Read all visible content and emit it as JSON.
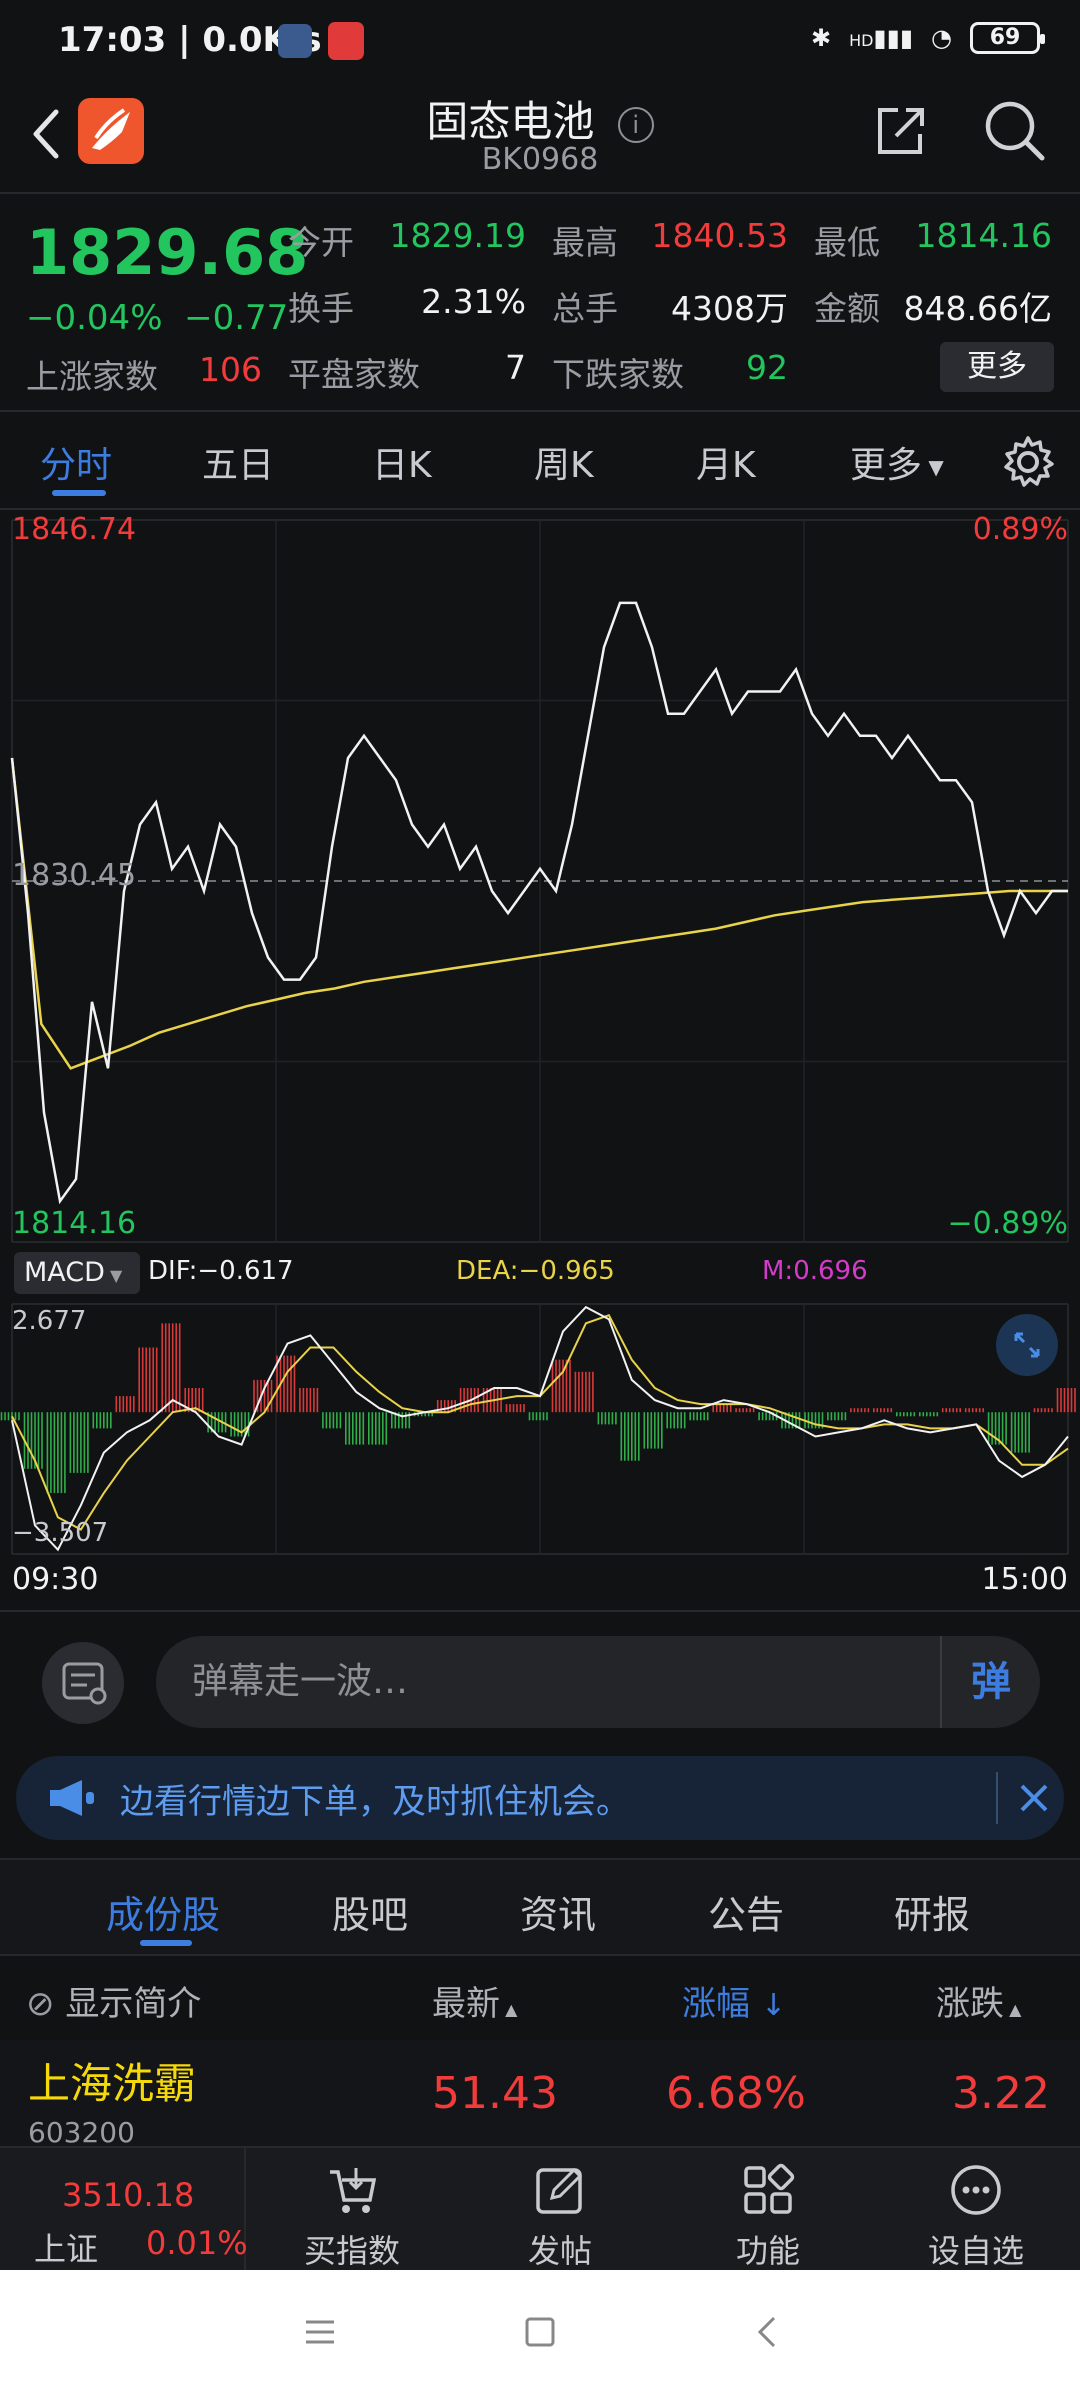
{
  "status_bar": {
    "time": "17:03",
    "network_speed": "0.0K/s",
    "battery": "69",
    "signal_label": "HD"
  },
  "header": {
    "title": "固态电池",
    "code": "BK0968",
    "icons": [
      "back-icon",
      "app-logo",
      "info-icon",
      "share-icon",
      "search-icon"
    ]
  },
  "quote": {
    "price": "1829.68",
    "change_pct": "−0.04%",
    "change": "−0.77",
    "open_label": "今开",
    "open": "1829.19",
    "high_label": "最高",
    "high": "1840.53",
    "low_label": "最低",
    "low": "1814.16",
    "turnover_label": "换手",
    "turnover": "2.31%",
    "volume_label": "总手",
    "volume": "4308万",
    "amount_label": "金额",
    "amount": "848.66亿",
    "up_label": "上涨家数",
    "up_count": "106",
    "flat_label": "平盘家数",
    "flat_count": "7",
    "down_label": "下跌家数",
    "down_count": "92",
    "more": "更多"
  },
  "tabs": [
    "分时",
    "五日",
    "日K",
    "周K",
    "月K",
    "更多"
  ],
  "chart_data": {
    "type": "line",
    "price_top": "1846.74",
    "price_mid": "1830.45",
    "price_bottom": "1814.16",
    "pct_top": "0.89%",
    "pct_bottom": "−0.89%",
    "time_start": "09:30",
    "time_end": "15:00",
    "ylim": [
      1814.16,
      1846.74
    ],
    "price_series": [
      1836,
      1829,
      1820,
      1816,
      1817,
      1825,
      1822,
      1830,
      1833,
      1834,
      1831,
      1832,
      1830,
      1833,
      1832,
      1829,
      1827,
      1826,
      1826,
      1827,
      1832,
      1836,
      1837,
      1836,
      1835,
      1833,
      1832,
      1833,
      1831,
      1832,
      1830,
      1829,
      1830,
      1831,
      1830,
      1833,
      1837,
      1841,
      1843,
      1843,
      1841,
      1838,
      1838,
      1839,
      1840,
      1838,
      1839,
      1839,
      1839,
      1840,
      1838,
      1837,
      1838,
      1837,
      1837,
      1836,
      1837,
      1836,
      1835,
      1835,
      1834,
      1830,
      1828,
      1830,
      1829,
      1830,
      1830
    ],
    "avg_series": [
      1836,
      1824,
      1822,
      1822.5,
      1823,
      1823.6,
      1824,
      1824.4,
      1824.8,
      1825.1,
      1825.4,
      1825.6,
      1825.9,
      1826.1,
      1826.3,
      1826.5,
      1826.7,
      1826.9,
      1827.1,
      1827.3,
      1827.5,
      1827.7,
      1827.9,
      1828.1,
      1828.3,
      1828.6,
      1828.9,
      1829.1,
      1829.3,
      1829.5,
      1829.6,
      1829.7,
      1829.8,
      1829.9,
      1830.0,
      1830.0,
      1830.0
    ],
    "macd": {
      "indicator": "MACD",
      "dif_label": "DIF:−0.617",
      "dea_label": "DEA:−0.965",
      "m_label": "M:0.696",
      "ylim_top": "2.677",
      "ylim_bottom": "−3.507",
      "range": [
        -3.507,
        2.677
      ],
      "dif_series": [
        -0.2,
        -2.8,
        -3.4,
        -2.3,
        -1.0,
        -0.5,
        -0.2,
        0.3,
        0.0,
        -0.6,
        -0.8,
        0.6,
        1.7,
        1.9,
        1.2,
        0.5,
        0.1,
        -0.1,
        0.0,
        0.1,
        0.3,
        0.6,
        0.6,
        0.4,
        2.0,
        2.6,
        2.3,
        0.8,
        0.3,
        0.1,
        0.1,
        0.3,
        0.2,
        0.0,
        -0.3,
        -0.6,
        -0.5,
        -0.4,
        -0.2,
        -0.4,
        -0.5,
        -0.4,
        -0.3,
        -1.2,
        -1.6,
        -1.3,
        -0.6
      ],
      "dea_series": [
        -0.1,
        -1.2,
        -2.6,
        -2.9,
        -2.0,
        -1.2,
        -0.6,
        0.0,
        0.1,
        -0.2,
        -0.5,
        0.0,
        1.0,
        1.6,
        1.6,
        1.0,
        0.5,
        0.1,
        0.0,
        0.0,
        0.2,
        0.3,
        0.4,
        0.4,
        1.0,
        2.2,
        2.4,
        1.3,
        0.6,
        0.3,
        0.2,
        0.2,
        0.2,
        0.1,
        -0.1,
        -0.3,
        -0.4,
        -0.4,
        -0.3,
        -0.3,
        -0.4,
        -0.4,
        -0.3,
        -0.7,
        -1.3,
        -1.3,
        -0.9
      ],
      "hist_series": [
        -0.2,
        -1.4,
        -2.0,
        -1.5,
        -0.4,
        0.4,
        1.6,
        2.2,
        0.6,
        -0.5,
        -0.6,
        0.8,
        1.4,
        0.6,
        -0.4,
        -0.8,
        -0.8,
        -0.4,
        -0.1,
        0.3,
        0.6,
        0.6,
        0.2,
        -0.2,
        1.3,
        1.0,
        -0.3,
        -1.2,
        -0.9,
        -0.4,
        -0.2,
        0.2,
        0.1,
        -0.2,
        -0.4,
        -0.4,
        -0.2,
        0.1,
        0.1,
        -0.1,
        -0.1,
        0.1,
        0.1,
        -0.8,
        -1.0,
        0.1,
        0.6
      ]
    }
  },
  "danmu": {
    "placeholder": "弹幕走一波…",
    "send": "弹"
  },
  "banner": {
    "text": "边看行情边下单，及时抓住机会。"
  },
  "subtabs": [
    "成份股",
    "股吧",
    "资讯",
    "公告",
    "研报"
  ],
  "table": {
    "toggle": "显示简介",
    "col_latest": "最新",
    "col_pct": "涨幅",
    "col_change": "涨跌",
    "rows": [
      {
        "name": "上海洗霸",
        "code": "603200",
        "latest": "51.43",
        "pct": "6.68%",
        "change": "3.22"
      }
    ]
  },
  "bottom_bar": {
    "index_value": "3510.18",
    "index_name": "上证",
    "index_pct": "0.01%",
    "items": [
      "买指数",
      "发帖",
      "功能",
      "设自选"
    ]
  }
}
